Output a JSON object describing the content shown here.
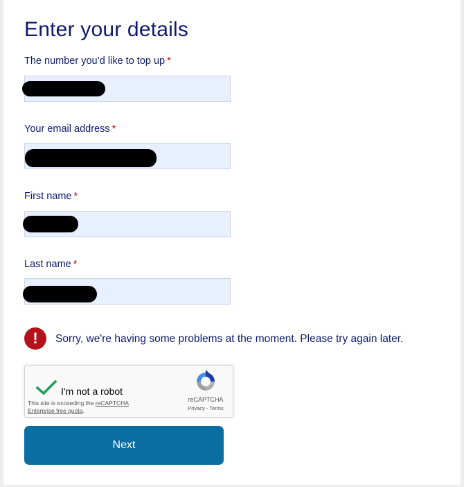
{
  "page": {
    "title": "Enter your details"
  },
  "form": {
    "fields": [
      {
        "label": "The number you’d like to top up",
        "required_mark": "*"
      },
      {
        "label": "Your email address",
        "required_mark": "*"
      },
      {
        "label": "First name",
        "required_mark": "*"
      },
      {
        "label": "Last name",
        "required_mark": "*"
      }
    ],
    "error": {
      "icon": "!",
      "message": "Sorry, we're having some problems at the moment. Please try again later."
    },
    "captcha": {
      "label": "I'm not a robot",
      "quota_prefix": "This site is exceeding the ",
      "quota_link": "reCAPTCHA Enterprise free quota",
      "quota_suffix": ".",
      "brand": "reCAPTCHA",
      "privacy": "Privacy",
      "separator": " - ",
      "terms": "Terms"
    },
    "next_label": "Next"
  },
  "colors": {
    "heading": "#0d1a6b",
    "required": "#d0021b",
    "field_bg": "#e8efff",
    "error": "#b5121b",
    "button": "#0b6ea3"
  }
}
